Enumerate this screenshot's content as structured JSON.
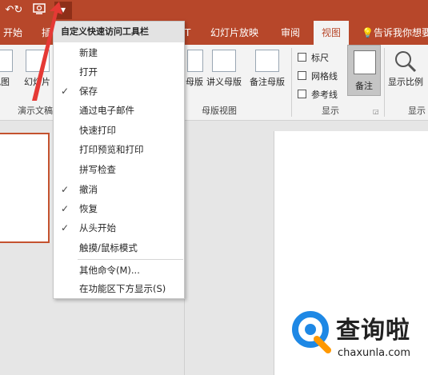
{
  "quick_access": {
    "icons": [
      "undo-icon",
      "redo-icon",
      "start-slideshow-icon",
      "customize-qat-icon"
    ],
    "customize_glyph": "▾"
  },
  "tabs": [
    {
      "label": "开始"
    },
    {
      "label": "插"
    },
    {
      "label": "T"
    },
    {
      "label": "幻灯片放映"
    },
    {
      "label": "审阅"
    },
    {
      "label": "视图",
      "active": true
    },
    {
      "label": "告诉我你想要"
    }
  ],
  "ribbon": {
    "buttons": {
      "view": "视图",
      "slide": "幻灯片",
      "handout_master": "母版",
      "notes_master_handout": "讲义母版",
      "notes_master": "备注母版",
      "notes": "备注",
      "zoom_ratio": "显示比例"
    },
    "groups": {
      "presentation_views": "演示文稿",
      "master_views": "母版视图",
      "show": "显示",
      "zoom": "显示"
    },
    "checkboxes": [
      {
        "label": "标尺",
        "checked": false
      },
      {
        "label": "网格线",
        "checked": false
      },
      {
        "label": "参考线",
        "checked": false
      }
    ]
  },
  "menu": {
    "header": "自定义快速访问工具栏",
    "items": [
      {
        "label": "新建",
        "checked": false
      },
      {
        "label": "打开",
        "checked": false
      },
      {
        "label": "保存",
        "checked": true
      },
      {
        "label": "通过电子邮件",
        "checked": false
      },
      {
        "label": "快速打印",
        "checked": false
      },
      {
        "label": "打印预览和打印",
        "checked": false
      },
      {
        "label": "拼写检查",
        "checked": false
      },
      {
        "label": "撤消",
        "checked": true
      },
      {
        "label": "恢复",
        "checked": true
      },
      {
        "label": "从头开始",
        "checked": true
      },
      {
        "label": "触摸/鼠标模式",
        "checked": false
      }
    ],
    "more_commands": "其他命令(M)...",
    "show_below_ribbon": "在功能区下方显示(S)"
  },
  "watermark": {
    "text": "查询啦",
    "url": "chaxunla.com"
  },
  "colors": {
    "accent": "#b7472a",
    "arrow": "#e53935",
    "logo_blue": "#1e88e5",
    "logo_orange": "#ff9800"
  }
}
